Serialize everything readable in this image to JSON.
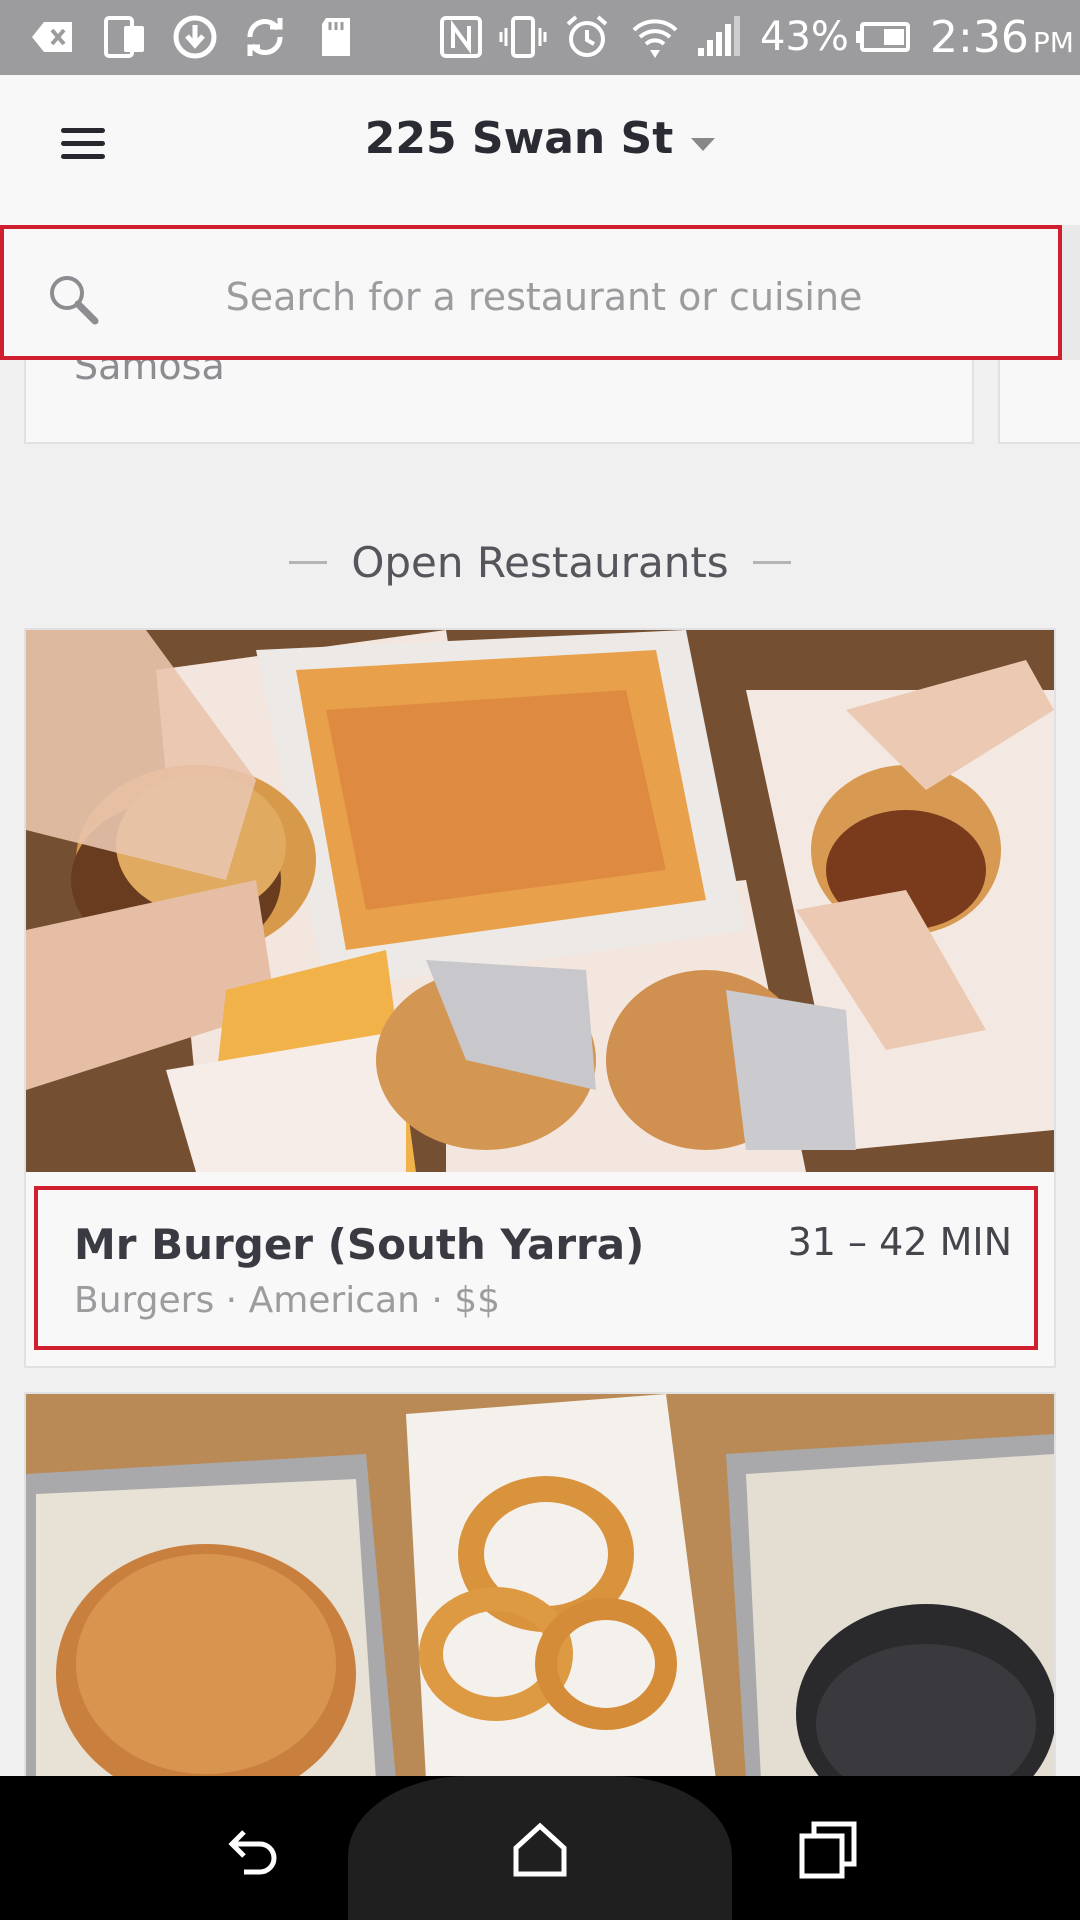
{
  "status_bar": {
    "icons": [
      "back-to-app-icon",
      "phone-sim-icon",
      "download-icon",
      "sync-icon",
      "sd-card-icon",
      "nfc-icon",
      "vibrate-icon",
      "alarm-icon",
      "wifi-icon",
      "cell-signal-icon",
      "battery-icon"
    ],
    "battery_percent": "43%",
    "time": "2:36",
    "ampm": "PM"
  },
  "header": {
    "menu_icon": "hamburger-menu-icon",
    "location": "225 Swan St",
    "location_dropdown_icon": "caret-down-icon"
  },
  "search": {
    "icon": "search-icon",
    "placeholder": "Search for a restaurant or cuisine"
  },
  "categories": [
    {
      "label": "Samosa"
    },
    {
      "label": ""
    }
  ],
  "section": {
    "title": "Open Restaurants"
  },
  "restaurants": [
    {
      "name": "Mr Burger (South Yarra)",
      "tags": "Burgers · American · $$",
      "eta": "31 – 42 MIN",
      "image": "burgers-and-loaded-fries-photo"
    },
    {
      "image": "burgers-and-onion-rings-photo"
    }
  ],
  "nav_bar": {
    "back": "back-icon",
    "home": "home-icon",
    "recents": "recents-icon"
  },
  "colors": {
    "highlight_border": "#d0202f",
    "status_bar_bg": "#9c9c9f",
    "nav_bar_bg": "#000000"
  }
}
